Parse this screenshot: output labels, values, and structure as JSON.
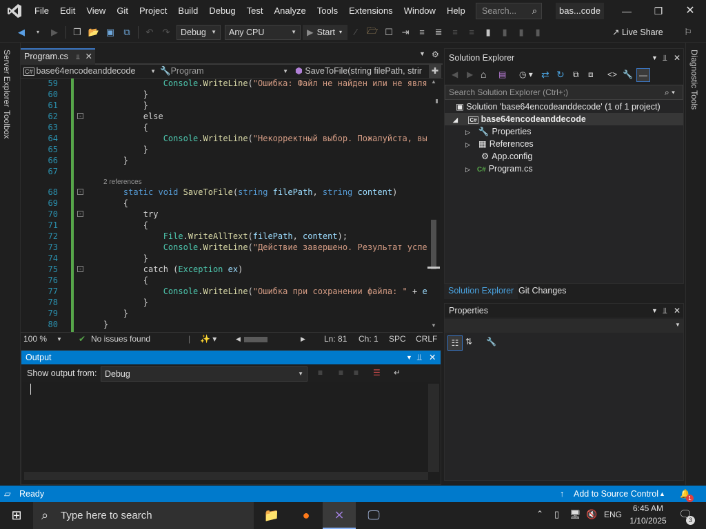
{
  "menu": {
    "items": [
      "File",
      "Edit",
      "View",
      "Git",
      "Project",
      "Build",
      "Debug",
      "Test",
      "Analyze",
      "Tools",
      "Extensions",
      "Window",
      "Help"
    ],
    "search_placeholder": "Search...",
    "solution_short": "bas...code"
  },
  "toolbar": {
    "config": "Debug",
    "platform": "Any CPU",
    "start_label": "Start",
    "live_share": "Live Share"
  },
  "side_tabs": {
    "left": [
      "Server Explorer",
      "Toolbox"
    ],
    "right": "Diagnostic Tools"
  },
  "editor": {
    "tab_label": "Program.cs",
    "nav_project": "base64encodeanddecode",
    "nav_class": "Program",
    "nav_member": "SaveToFile(string filePath, strir",
    "lines": [
      {
        "n": "59",
        "fold": "",
        "tokens": [
          [
            "",
            "            "
          ],
          [
            "ty",
            "Console"
          ],
          [
            "",
            "."
          ],
          [
            "mt",
            "WriteLine"
          ],
          [
            "",
            "("
          ],
          [
            "st",
            "\"Ошибка: Файл не найден или не являет"
          ]
        ]
      },
      {
        "n": "60",
        "fold": "",
        "tokens": [
          [
            "",
            "        }"
          ]
        ]
      },
      {
        "n": "61",
        "fold": "",
        "tokens": [
          [
            "",
            "        }"
          ]
        ]
      },
      {
        "n": "62",
        "fold": "-",
        "tokens": [
          [
            "",
            "        else"
          ]
        ]
      },
      {
        "n": "63",
        "fold": "",
        "tokens": [
          [
            "",
            "        {"
          ]
        ]
      },
      {
        "n": "64",
        "fold": "",
        "tokens": [
          [
            "",
            "            "
          ],
          [
            "ty",
            "Console"
          ],
          [
            "",
            "."
          ],
          [
            "mt",
            "WriteLine"
          ],
          [
            "",
            "("
          ],
          [
            "st",
            "\"Некорректный выбор. Пожалуйста, выберите"
          ]
        ]
      },
      {
        "n": "65",
        "fold": "",
        "tokens": [
          [
            "",
            "        }"
          ]
        ]
      },
      {
        "n": "66",
        "fold": "",
        "tokens": [
          [
            "",
            "    }"
          ]
        ]
      },
      {
        "n": "67",
        "fold": "",
        "tokens": [
          [
            "",
            ""
          ]
        ]
      },
      {
        "n": "68",
        "fold": "-",
        "refs": "2 references",
        "tokens": [
          [
            "",
            "    "
          ],
          [
            "kw",
            "static void "
          ],
          [
            "mt",
            "SaveToFile"
          ],
          [
            "",
            "("
          ],
          [
            "kw",
            "string "
          ],
          [
            "pm",
            "filePath"
          ],
          [
            "",
            ", "
          ],
          [
            "kw",
            "string "
          ],
          [
            "pm",
            "content"
          ],
          [
            "",
            ")"
          ]
        ]
      },
      {
        "n": "69",
        "fold": "",
        "tokens": [
          [
            "",
            "    {"
          ]
        ]
      },
      {
        "n": "70",
        "fold": "-",
        "tokens": [
          [
            "",
            "        try"
          ]
        ]
      },
      {
        "n": "71",
        "fold": "",
        "tokens": [
          [
            "",
            "        {"
          ]
        ]
      },
      {
        "n": "72",
        "fold": "",
        "tokens": [
          [
            "",
            "            "
          ],
          [
            "ty",
            "File"
          ],
          [
            "",
            "."
          ],
          [
            "mt",
            "WriteAllText"
          ],
          [
            "",
            "("
          ],
          [
            "pm",
            "filePath"
          ],
          [
            "",
            ", "
          ],
          [
            "pm",
            "content"
          ],
          [
            "",
            ");"
          ]
        ]
      },
      {
        "n": "73",
        "fold": "",
        "tokens": [
          [
            "",
            "            "
          ],
          [
            "ty",
            "Console"
          ],
          [
            "",
            "."
          ],
          [
            "mt",
            "WriteLine"
          ],
          [
            "",
            "("
          ],
          [
            "st",
            "\"Действие завершено. Результат успешно со"
          ]
        ]
      },
      {
        "n": "74",
        "fold": "",
        "tokens": [
          [
            "",
            "        }"
          ]
        ]
      },
      {
        "n": "75",
        "fold": "-",
        "tokens": [
          [
            "",
            "        catch ("
          ],
          [
            "ty",
            "Exception"
          ],
          [
            "",
            ""
          ],
          [
            "pm",
            " ex"
          ],
          [
            "",
            ")"
          ]
        ]
      },
      {
        "n": "76",
        "fold": "",
        "tokens": [
          [
            "",
            "        {"
          ]
        ]
      },
      {
        "n": "77",
        "fold": "",
        "tokens": [
          [
            "",
            "            "
          ],
          [
            "ty",
            "Console"
          ],
          [
            "",
            "."
          ],
          [
            "mt",
            "WriteLine"
          ],
          [
            "",
            "("
          ],
          [
            "st",
            "\"Ошибка при сохранении файла: \""
          ],
          [
            "",
            " + "
          ],
          [
            "pm",
            "ex"
          ],
          [
            "",
            ".Mess"
          ]
        ]
      },
      {
        "n": "78",
        "fold": "",
        "tokens": [
          [
            "",
            "        }"
          ]
        ]
      },
      {
        "n": "79",
        "fold": "",
        "tokens": [
          [
            "",
            "    }"
          ]
        ]
      },
      {
        "n": "80",
        "fold": "",
        "tokens": [
          [
            "",
            "}"
          ]
        ]
      }
    ],
    "status": {
      "zoom": "100 %",
      "issues": "No issues found",
      "ln": "Ln: 81",
      "ch": "Ch: 1",
      "spc": "SPC",
      "crlf": "CRLF"
    }
  },
  "output": {
    "title": "Output",
    "show_from_label": "Show output from:",
    "source": "Debug"
  },
  "solution_explorer": {
    "title": "Solution Explorer",
    "search_placeholder": "Search Solution Explorer (Ctrl+;)",
    "solution": "Solution 'base64encodeanddecode' (1 of 1 project)",
    "project": "base64encodeanddecode",
    "items": [
      "Properties",
      "References",
      "App.config",
      "Program.cs"
    ],
    "tabs": [
      "Solution Explorer",
      "Git Changes"
    ]
  },
  "properties": {
    "title": "Properties"
  },
  "statusbar": {
    "ready": "Ready",
    "source_control": "Add to Source Control",
    "notifications": "1"
  },
  "taskbar": {
    "search_placeholder": "Type here to search",
    "lang": "ENG",
    "time": "6:45 AM",
    "date": "1/10/2025",
    "notif_count": "3"
  },
  "colors": {
    "accent": "#007acc",
    "vs_purple": "#a280e0",
    "gutter_green": "#57a64a"
  }
}
